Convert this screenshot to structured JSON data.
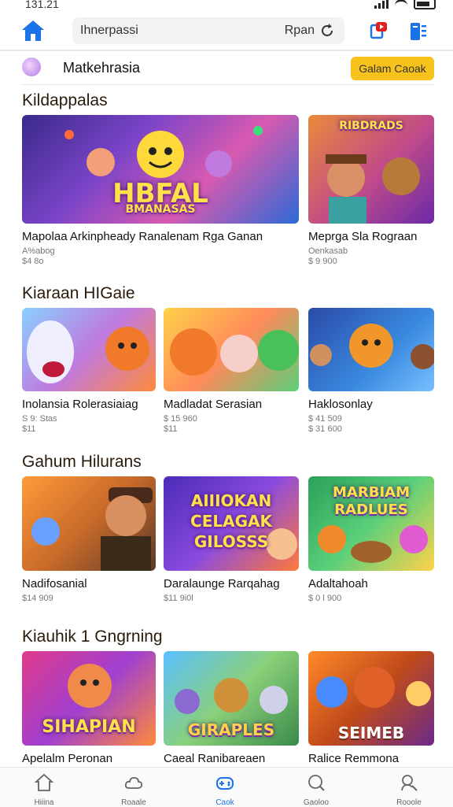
{
  "status_bar": {
    "time": "131.21"
  },
  "header": {
    "search_text": "Ihnerpassi",
    "search_action": "Rpan"
  },
  "user": {
    "name": "Matkehrasia",
    "cta_label": "Galam Caoak"
  },
  "sections": [
    {
      "title": "Kildappalas",
      "cards": [
        {
          "title": "Mapolaa Arkinpheady Ranalenam Rga Ganan",
          "subtitle": "A%abog",
          "price": "$4 8o",
          "logo": "HBFAL",
          "logo2": "BMANASAS"
        },
        {
          "title": "Meprga Sla Rograan",
          "subtitle": "Oenkasab",
          "price": "$ 9 900",
          "logo": "RIBDRADS"
        }
      ]
    },
    {
      "title": "Kiaraan HIGaie",
      "cards": [
        {
          "title": "Inolansia Rolerasiaiag",
          "subtitle": "S 9: Stas",
          "price": "$11"
        },
        {
          "title": "Madladat Serasian",
          "subtitle": "$ 15 960",
          "price": "$11"
        },
        {
          "title": "Haklosonlay",
          "subtitle": "$ 41 509",
          "price": "$ 31 600"
        }
      ]
    },
    {
      "title": "Gahum Hilurans",
      "cards": [
        {
          "title": "Nadifosanial",
          "subtitle": "$14 909",
          "price": ""
        },
        {
          "title": "Daralaunge Rarqahag",
          "subtitle": "$11 9i0l",
          "price": "",
          "logo": "AIIIOKAN CELAGAK GILOSSS"
        },
        {
          "title": "Adaltahoah",
          "subtitle": "$ 0 l 900",
          "price": "",
          "logo": "MARBIAM RADLUES"
        }
      ]
    },
    {
      "title": "Kiauhik 1 Gngrning",
      "cards": [
        {
          "title": "Apelalm Peronan",
          "logo": "SIHAPIAN"
        },
        {
          "title": "Caeal Ranibareaen",
          "logo": "GIRAPLES"
        },
        {
          "title": "Ralice Remmona",
          "logo": "SEIMEB"
        }
      ]
    }
  ],
  "bottom_nav": [
    {
      "label": "Hiiina",
      "icon": "home-outline-icon"
    },
    {
      "label": "Roaale",
      "icon": "cloud-icon"
    },
    {
      "label": "Caok",
      "icon": "game-controller-icon",
      "active": true
    },
    {
      "label": "Gaoloo",
      "icon": "search-icon"
    },
    {
      "label": "Rooole",
      "icon": "user-search-icon"
    }
  ],
  "colors": {
    "accent": "#1a73e8",
    "cta": "#f6c21b",
    "section_title": "#2a1a0a"
  }
}
